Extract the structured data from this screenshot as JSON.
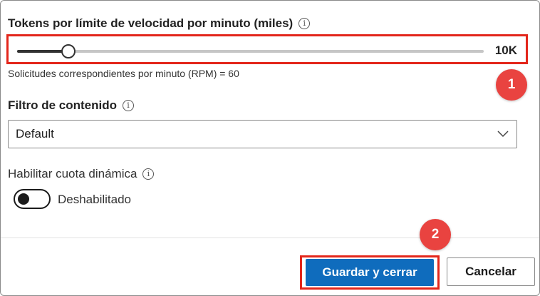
{
  "rate_limit": {
    "label": "Tokens por límite de velocidad por minuto (miles)",
    "slider_fraction": 0.11,
    "value_text": "10K",
    "rpm_text": "Solicitudes correspondientes por minuto (RPM) = 60"
  },
  "content_filter": {
    "label": "Filtro de contenido",
    "selected": "Default"
  },
  "dynamic_quota": {
    "label": "Habilitar cuota dinámica",
    "toggle_state": "Deshabilitado",
    "enabled": false
  },
  "actions": {
    "save_label": "Guardar y cerrar",
    "cancel_label": "Cancelar"
  },
  "callouts": [
    "1",
    "2"
  ],
  "colors": {
    "highlight": "#e3261b",
    "badge": "#e94340",
    "primary": "#0f6cbd"
  }
}
